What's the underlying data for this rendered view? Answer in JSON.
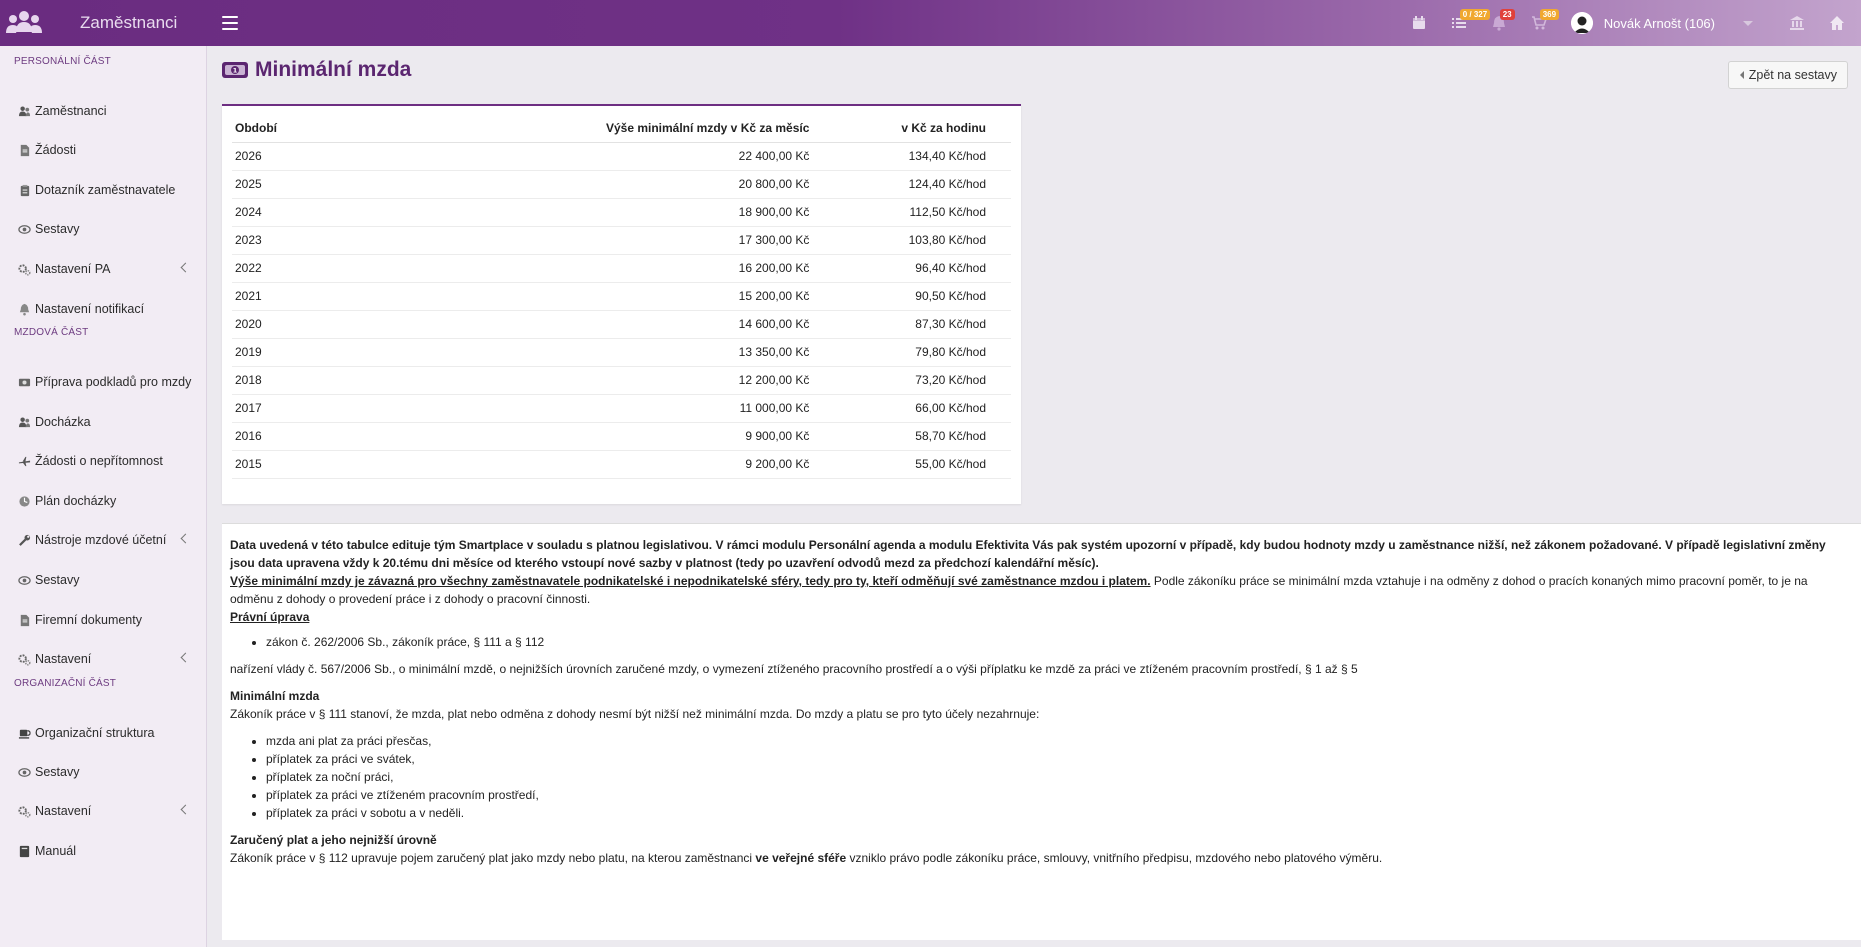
{
  "app": {
    "title": "Zaměstnanci"
  },
  "topbar": {
    "tasks_badge": "0 / 327",
    "notifications_badge": "23",
    "cart_badge": "369",
    "user_name": "Novák Arnošt (106)"
  },
  "sidebar": {
    "section_personal": "PERSONÁLNÍ ČÁST",
    "section_payroll": "MZDOVÁ ČÁST",
    "section_org": "ORGANIZAČNÍ ČÁST",
    "items": [
      {
        "label": "Zaměstnanci",
        "icon": "users-icon"
      },
      {
        "label": "Žádosti",
        "icon": "file-icon"
      },
      {
        "label": "Dotazník zaměstnavatele",
        "icon": "clipboard-icon"
      },
      {
        "label": "Sestavy",
        "icon": "eye-icon"
      },
      {
        "label": "Nastavení PA",
        "icon": "gears-icon"
      },
      {
        "label": "Nastavení notifikací",
        "icon": "bell-icon"
      },
      {
        "label": "Příprava podkladů pro mzdy",
        "icon": "money-icon"
      },
      {
        "label": "Docházka",
        "icon": "users-icon"
      },
      {
        "label": "Žádosti o nepřítomnost",
        "icon": "plane-icon"
      },
      {
        "label": "Plán docházky",
        "icon": "clock-icon"
      },
      {
        "label": "Nástroje mzdové účetní",
        "icon": "wrench-icon"
      },
      {
        "label": "Sestavy",
        "icon": "eye-icon"
      },
      {
        "label": "Firemní dokumenty",
        "icon": "file-icon"
      },
      {
        "label": "Nastavení",
        "icon": "gears-icon"
      },
      {
        "label": "Organizační struktura",
        "icon": "coffee-icon"
      },
      {
        "label": "Sestavy",
        "icon": "eye-icon"
      },
      {
        "label": "Nastavení",
        "icon": "gears-icon"
      },
      {
        "label": "Manuál",
        "icon": "book-icon"
      }
    ]
  },
  "page": {
    "title": "Minimální mzda",
    "back_button": "Zpět na sestavy"
  },
  "table": {
    "headers": [
      "Období",
      "Výše minimální mzdy v Kč za měsíc",
      "v Kč za hodinu"
    ],
    "rows": [
      [
        "2026",
        "22 400,00 Kč",
        "134,40 Kč/hod"
      ],
      [
        "2025",
        "20 800,00 Kč",
        "124,40 Kč/hod"
      ],
      [
        "2024",
        "18 900,00 Kč",
        "112,50 Kč/hod"
      ],
      [
        "2023",
        "17 300,00 Kč",
        "103,80 Kč/hod"
      ],
      [
        "2022",
        "16 200,00 Kč",
        "96,40 Kč/hod"
      ],
      [
        "2021",
        "15 200,00 Kč",
        "90,50 Kč/hod"
      ],
      [
        "2020",
        "14 600,00 Kč",
        "87,30 Kč/hod"
      ],
      [
        "2019",
        "13 350,00 Kč",
        "79,80 Kč/hod"
      ],
      [
        "2018",
        "12 200,00 Kč",
        "73,20 Kč/hod"
      ],
      [
        "2017",
        "11 000,00 Kč",
        "66,00 Kč/hod"
      ],
      [
        "2016",
        "9 900,00 Kč",
        "58,70 Kč/hod"
      ],
      [
        "2015",
        "9 200,00 Kč",
        "55,00 Kč/hod"
      ]
    ]
  },
  "info": {
    "intro": "Data uvedená v této tabulce edituje tým Smartplace v souladu s platnou legislativou. V rámci modulu Personální agenda a modulu Efektivita Vás pak systém upozorní v případě, kdy budou hodnoty mzdy u zaměstnance nižší, než zákonem požadované. V případě legislativní změny jsou data upravena vždy k 20.tému dni měsíce od kterého vstoupí nové sazby v platnost (tedy po uzavření odvodů mezd za předchozí kalendářní měsíc).",
    "lead_underlined": "Výše minimální mzdy je závazná pro všechny zaměstnavatele podnikatelské i nepodnikatelské sféry, tedy pro ty, kteří odměňují své zaměstnance mzdou i platem.",
    "lead_rest": " Podle zákoníku práce se minimální mzda vztahuje i na odměny z dohod o pracích konaných mimo pracovní poměr, to je na odměnu z dohody o provedení práce i z dohody o pracovní činnosti.",
    "legal_heading": "Právní úprava",
    "legal_item_1": "zákon č. 262/2006 Sb., zákoník práce, § 111 a § 112",
    "legal_item_2": "nařízení vlády č. 567/2006 Sb., o minimální mzdě, o nejnižších úrovních zaručené mzdy, o vymezení ztíženého pracovního prostředí a o výši příplatku ke mzdě za práci ve ztíženém pracovním prostředí, § 1 až § 5",
    "min_heading": "Minimální mzda",
    "min_text": "Zákoník práce v § 111 stanoví, že mzda, plat nebo odměna z dohody nesmí být nižší než minimální mzda. Do mzdy a platu se pro tyto účely nezahrnuje:",
    "exclusions": [
      "mzda ani plat za práci přesčas,",
      "příplatek za práci ve svátek,",
      "příplatek za noční práci,",
      "příplatek za práci ve ztíženém pracovním prostředí,",
      "příplatek za práci v sobotu a v neděli."
    ],
    "guaranteed_heading": "Zaručený plat a jeho nejnižší úrovně",
    "guaranteed_pre": "Zákoník práce v § 112 upravuje pojem zaručený plat jako mzdy nebo platu, na kterou zaměstnanci ",
    "guaranteed_bold": "ve veřejné sféře",
    "guaranteed_post": " vzniklo právo podle zákoníku práce, smlouvy, vnitřního předpisu, mzdového nebo platového výměru."
  },
  "colors": {
    "brand": "#6a2c80",
    "title": "#5b2670",
    "badge_orange": "#f0a830",
    "badge_red": "#e0413a"
  }
}
